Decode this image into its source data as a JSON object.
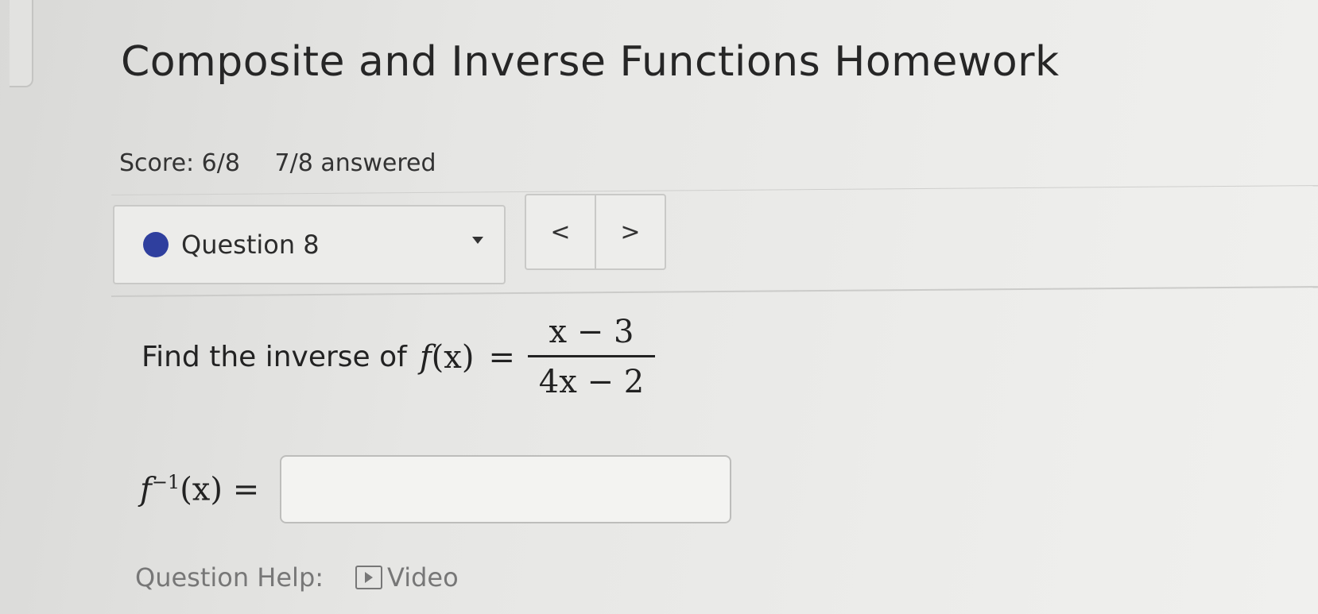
{
  "page": {
    "title": "Composite and Inverse Functions Homework",
    "score_label": "Score: 6/8",
    "answered_label": "7/8 answered"
  },
  "question_nav": {
    "selected_label": "Question 8",
    "status_color": "#2f3f9e",
    "prev_symbol": "<",
    "next_symbol": ">"
  },
  "question": {
    "prompt": "Find the inverse of",
    "func_lhs_fn": "f",
    "func_lhs_arg": "(x)",
    "equals": "=",
    "numerator": "x − 3",
    "denominator": "4x − 2"
  },
  "answer": {
    "label_fn": "f",
    "label_exp": "−1",
    "label_arg": "(x) =",
    "value": "",
    "placeholder": ""
  },
  "help": {
    "label": "Question Help:",
    "video_label": "Video"
  }
}
